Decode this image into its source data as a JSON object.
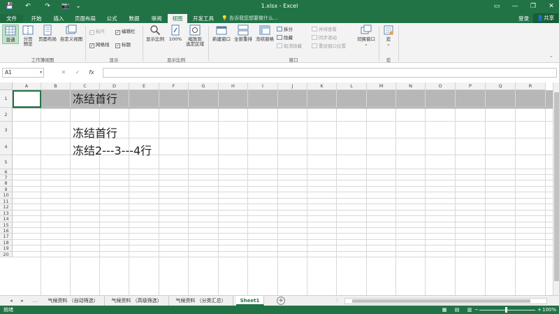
{
  "titlebar": {
    "title": "1.xlsx - Excel",
    "save_icon": "💾",
    "undo_icon": "↶",
    "redo_icon": "↷",
    "camera_icon": "📷",
    "more_icon": "⌄",
    "ribbon_opts": "▭",
    "minimize": "—",
    "restore": "❐",
    "close": "✕"
  },
  "tabs": [
    "文件",
    "开始",
    "插入",
    "页面布局",
    "公式",
    "数据",
    "审阅",
    "视图",
    "开发工具"
  ],
  "tellme": "告诉我您想要做什么...",
  "login": "登录",
  "share": "共享",
  "ribbon": {
    "views": {
      "normal": "普通",
      "pagebreak": "分页\n预览",
      "pagelayout": "页面布局",
      "custom": "自定义视图",
      "group": "工作簿视图"
    },
    "show": {
      "ruler": "标尺",
      "gridlines": "网格线",
      "formulabar": "编辑栏",
      "headings": "标题",
      "group": "显示"
    },
    "zoom": {
      "zoom": "显示比例",
      "hundred": "100%",
      "selection": "缩放到\n选定区域",
      "group": "显示比例"
    },
    "window": {
      "newwin": "新建窗口",
      "arrange": "全部重排",
      "freeze": "冻结窗格",
      "split": "拆分",
      "hide": "隐藏",
      "unhide": "取消隐藏",
      "side": "并排查看",
      "sync": "同步滚动",
      "reset": "重设窗口位置",
      "switch": "切换窗口",
      "group": "窗口"
    },
    "macro": {
      "macros": "宏",
      "group": "宏"
    }
  },
  "formula": {
    "namebox": "A1",
    "cancel": "✕",
    "enter": "✓",
    "fx": "fx",
    "value": ""
  },
  "columns": [
    "A",
    "B",
    "C",
    "D",
    "E",
    "F",
    "G",
    "H",
    "I",
    "J",
    "K",
    "L",
    "M",
    "N",
    "O",
    "P",
    "Q",
    "R"
  ],
  "rows": [
    "1",
    "2",
    "3",
    "4",
    "5",
    "6",
    "7",
    "8",
    "9",
    "10",
    "11",
    "12",
    "13",
    "14",
    "15",
    "16",
    "17",
    "18",
    "19",
    "20"
  ],
  "cells": {
    "c1": "冻结首行",
    "c3": "冻结首行",
    "c4": "冻结2---3---4行"
  },
  "sheets": {
    "ellipsis": "...",
    "tabs": [
      "气候资料 （自动筛选）",
      "气候资料 （高级筛选）",
      "气候资料 （分类汇总）",
      "Sheet1"
    ],
    "active_index": 3,
    "add": "+"
  },
  "status": {
    "ready": "就绪",
    "zoom": "100%",
    "zoom_level": 1.0
  }
}
